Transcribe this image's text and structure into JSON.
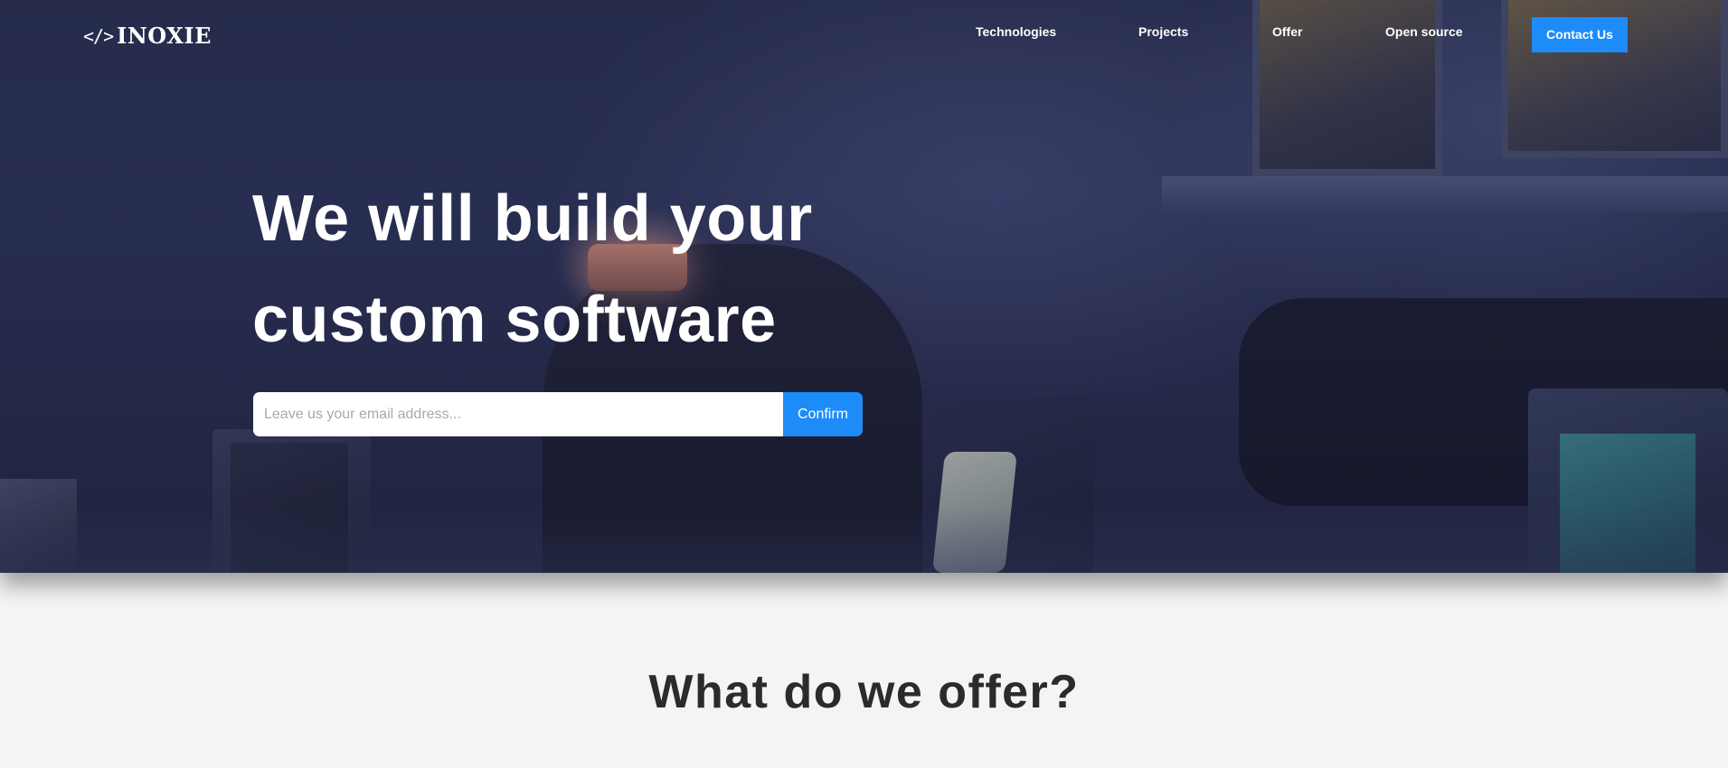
{
  "brand": {
    "logo_icon": "</>",
    "logo_text": "INOXIE"
  },
  "nav": {
    "items": [
      {
        "label": "Technologies"
      },
      {
        "label": "Projects"
      },
      {
        "label": "Offer"
      },
      {
        "label": "Open source"
      }
    ],
    "contact_label": "Contact Us"
  },
  "hero": {
    "title_line1": "We will build your",
    "title_line2": "custom software",
    "email_placeholder": "Leave us your email address...",
    "email_value": "",
    "confirm_label": "Confirm"
  },
  "offer": {
    "title": "What do we offer?"
  },
  "colors": {
    "accent": "#1d8cf8",
    "page_background": "#f4f4f4",
    "heading_dark": "#2b2b2b",
    "hero_overlay": "#2a3050"
  }
}
